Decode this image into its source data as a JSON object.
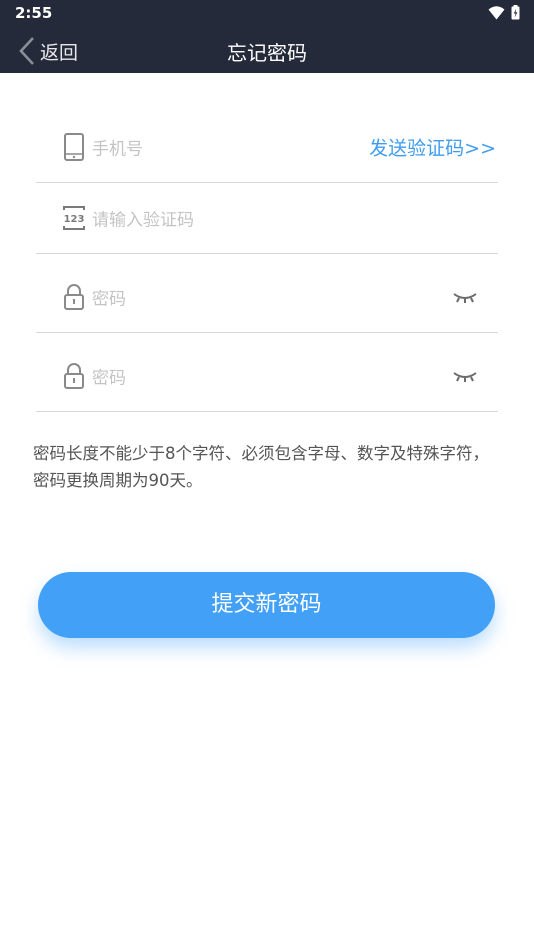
{
  "status_bar": {
    "time": "2:55"
  },
  "nav": {
    "back_label": "返回",
    "title": "忘记密码"
  },
  "form": {
    "phone_placeholder": "手机号",
    "send_code_label": "发送验证码>>",
    "code_placeholder": "请输入验证码",
    "code_icon_text": "123",
    "password_placeholder": "密码",
    "confirm_password_placeholder": "密码"
  },
  "hint": "密码长度不能少于8个字符、必须包含字母、数字及特殊字符，密码更换周期为90天。",
  "submit_label": "提交新密码",
  "colors": {
    "header_bg": "#252a3a",
    "accent": "#43a0f7",
    "link": "#3f9cf0"
  }
}
